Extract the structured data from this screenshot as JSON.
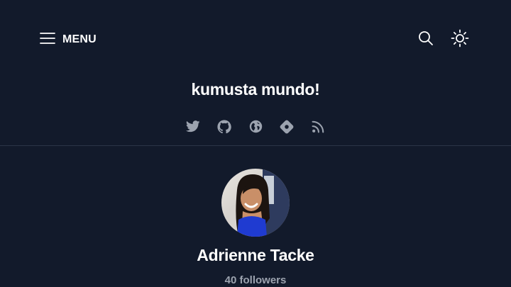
{
  "header": {
    "menu_label": "MENU",
    "icons": {
      "menu": "hamburger-icon",
      "search": "search-icon",
      "theme": "sun-icon"
    }
  },
  "blog": {
    "title": "kumusta mundo!"
  },
  "social": [
    {
      "icon": "twitter-icon"
    },
    {
      "icon": "github-icon"
    },
    {
      "icon": "globe-icon"
    },
    {
      "icon": "hashnode-icon"
    },
    {
      "icon": "rss-icon"
    }
  ],
  "author": {
    "name": "Adrienne Tacke",
    "followers": "40 followers"
  },
  "colors": {
    "background": "#121a2b",
    "text": "#ffffff",
    "muted": "#9ca3af",
    "icon": "#9ca3af",
    "divider": "#2b3447"
  }
}
